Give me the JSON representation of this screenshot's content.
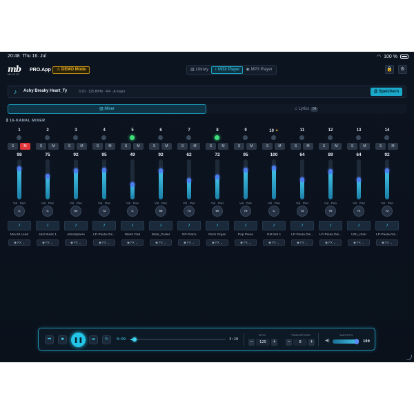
{
  "status": {
    "time": "20:48",
    "date": "Thu 16. Jul",
    "battery": "100 %"
  },
  "header": {
    "logo_text": "mb",
    "logo_sub": "MUSIC",
    "app_name": "PRO.App",
    "demo_badge": "DEMO Mode",
    "tabs": [
      {
        "label": "Library",
        "icon": "library-icon",
        "active": false
      },
      {
        "label": "MIDI Player",
        "icon": "note-icon",
        "active": true
      },
      {
        "label": "MP3 Player",
        "icon": "disc-icon",
        "active": false
      }
    ]
  },
  "song": {
    "title": "Achy Breaky Heart_Ty",
    "meta": "3:20 · 125 BPM · 4/4 · A major",
    "save_label": "Speichern"
  },
  "main_tabs": [
    {
      "label": "Mixer",
      "active": true
    },
    {
      "label": "Lyrics",
      "badge": "54",
      "active": false
    }
  ],
  "mixer_title": "16-KANAL MIXER",
  "channels": [
    {
      "num": "1",
      "led": false,
      "solo": "S",
      "mute": "M",
      "muted": true,
      "vol": "98",
      "pan": "C",
      "inst": "Mini M Lead",
      "fx": "FX",
      "star": false
    },
    {
      "num": "2",
      "led": false,
      "solo": "S",
      "mute": "M",
      "muted": false,
      "vol": "75",
      "pan": "C",
      "inst": "Jazz Bass 1",
      "fx": "FX",
      "star": false
    },
    {
      "num": "3",
      "led": false,
      "solo": "S",
      "mute": "M",
      "muted": false,
      "vol": "92",
      "pan": "54",
      "inst": "Atmosphere",
      "fx": "FX",
      "star": false
    },
    {
      "num": "4",
      "led": false,
      "solo": "S",
      "mute": "M",
      "muted": false,
      "vol": "95",
      "pan": "72",
      "inst": "LP-Paula Dis...",
      "fx": "FX",
      "star": false
    },
    {
      "num": "5",
      "led": true,
      "solo": "S",
      "mute": "M",
      "muted": false,
      "vol": "49",
      "pan": "C",
      "inst": "Warm Pad",
      "fx": "FX",
      "star": false
    },
    {
      "num": "6",
      "led": false,
      "solo": "S",
      "mute": "M",
      "muted": false,
      "vol": "92",
      "pan": "58",
      "inst": "Mute_Guitar",
      "fx": "FX",
      "star": false
    },
    {
      "num": "7",
      "led": false,
      "solo": "S",
      "mute": "M",
      "muted": false,
      "vol": "62",
      "pan": "73",
      "inst": "GP-Piano",
      "fx": "FX",
      "star": false
    },
    {
      "num": "8",
      "led": true,
      "solo": "S",
      "mute": "M",
      "muted": false,
      "vol": "72",
      "pan": "50",
      "inst": "Rock Organ",
      "fx": "FX",
      "star": false
    },
    {
      "num": "9",
      "led": false,
      "solo": "S",
      "mute": "M",
      "muted": false,
      "vol": "95",
      "pan": "73",
      "inst": "Pop Piano",
      "fx": "FX",
      "star": false
    },
    {
      "num": "10",
      "led": false,
      "solo": "S",
      "mute": "M",
      "muted": false,
      "vol": "100",
      "pan": "C",
      "inst": "GM Set 1",
      "fx": "FX",
      "star": true
    },
    {
      "num": "11",
      "led": false,
      "solo": "S",
      "mute": "M",
      "muted": false,
      "vol": "64",
      "pan": "72",
      "inst": "LP-Paula Dis...",
      "fx": "FX",
      "star": false
    },
    {
      "num": "12",
      "led": false,
      "solo": "S",
      "mute": "M",
      "muted": false,
      "vol": "89",
      "pan": "75",
      "inst": "LP-Paula Dis...",
      "fx": "FX",
      "star": false
    },
    {
      "num": "13",
      "led": false,
      "solo": "S",
      "mute": "M",
      "muted": false,
      "vol": "64",
      "pan": "74",
      "inst": "Uhh_choir",
      "fx": "FX",
      "star": false
    },
    {
      "num": "14",
      "led": false,
      "solo": "S",
      "mute": "M",
      "muted": false,
      "vol": "92",
      "pan": "72",
      "inst": "LP-Paula Dis...",
      "fx": "FX",
      "star": false
    }
  ],
  "labels": {
    "vol": "Vol",
    "pan": "Pan"
  },
  "transport": {
    "current_time": "0:09",
    "duration": "3:20",
    "progress": 0.045,
    "bpm_label": "BPM",
    "bpm": "125",
    "transpose_label": "TRANSPOSE",
    "transpose": "0",
    "master_label": "MASTER",
    "master": "100",
    "master_level": 1.0
  },
  "colors": {
    "accent": "#22c5e8",
    "mute": "#e0363c",
    "led_on": "#3ee07a",
    "demo": "#f0b429"
  }
}
